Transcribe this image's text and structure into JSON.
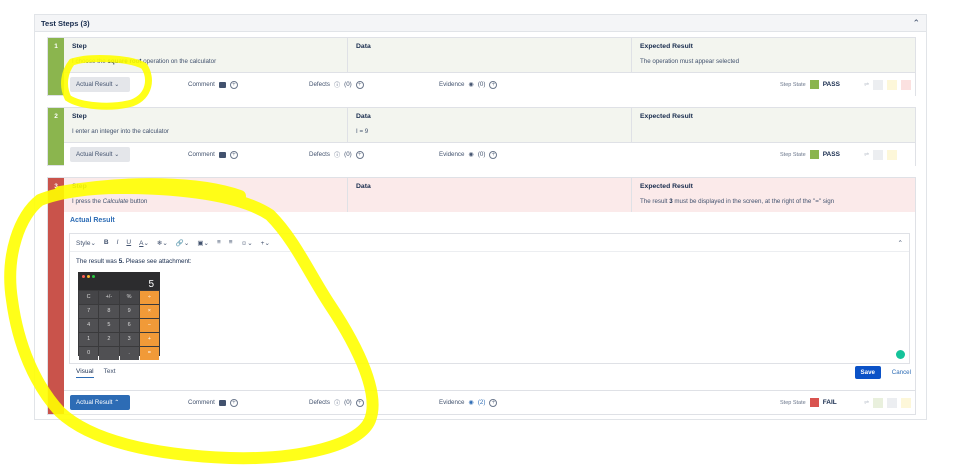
{
  "panel": {
    "title": "Test Steps (3)"
  },
  "columns": {
    "step": "Step",
    "data": "Data",
    "expected": "Expected Result"
  },
  "toolbar": {
    "actual_result": "Actual Result",
    "comment": "Comment",
    "defects": "Defects",
    "evidence": "Evidence",
    "step_state": "Step State"
  },
  "steps": [
    {
      "number": "1",
      "step_pre": "I choose the ",
      "step_bold": "square root",
      "step_post": " operation on the calculator",
      "data": "",
      "expected_pre": "The operation must appear selected",
      "expected_bold": "",
      "expected_post": "",
      "defects_count": "(0)",
      "evidence_count": "(0)",
      "state": "PASS",
      "state_color": "#8bb54e"
    },
    {
      "number": "2",
      "step_pre": "I enter an integer into the calculator",
      "step_bold": "",
      "step_post": "",
      "data": "I = 9",
      "expected_pre": "",
      "expected_bold": "",
      "expected_post": "",
      "defects_count": "(0)",
      "evidence_count": "(0)",
      "state": "PASS",
      "state_color": "#8bb54e"
    },
    {
      "number": "3",
      "step_pre": "I press the ",
      "step_bold": "Calculate",
      "step_post": " button",
      "data": "",
      "expected_pre": "The result ",
      "expected_bold": "3",
      "expected_post": " must be displayed in the screen, at the right of the \"=\" sign",
      "defects_count": "(0)",
      "evidence_count": "(2)",
      "state": "FAIL",
      "state_color": "#d9534f"
    }
  ],
  "editor": {
    "section_title": "Actual Result",
    "toolbar": {
      "style": "Style",
      "bold": "B",
      "italic": "I",
      "underline": "U",
      "text_color": "A"
    },
    "content_pre": "The result was ",
    "content_bold": "5.",
    "content_post": " Please see attachment:",
    "tab_visual": "Visual",
    "tab_text": "Text",
    "save": "Save",
    "cancel": "Cancel"
  },
  "calculator": {
    "display": "5",
    "keys": [
      "C",
      "+/-",
      "%",
      "÷",
      "7",
      "8",
      "9",
      "×",
      "4",
      "5",
      "6",
      "−",
      "1",
      "2",
      "3",
      "+",
      "0",
      "",
      ".",
      "="
    ]
  },
  "colors": {
    "pass": "#8bb54e",
    "fail": "#c9534b",
    "accent": "#2d6cb5",
    "highlight": "#ffff00"
  }
}
